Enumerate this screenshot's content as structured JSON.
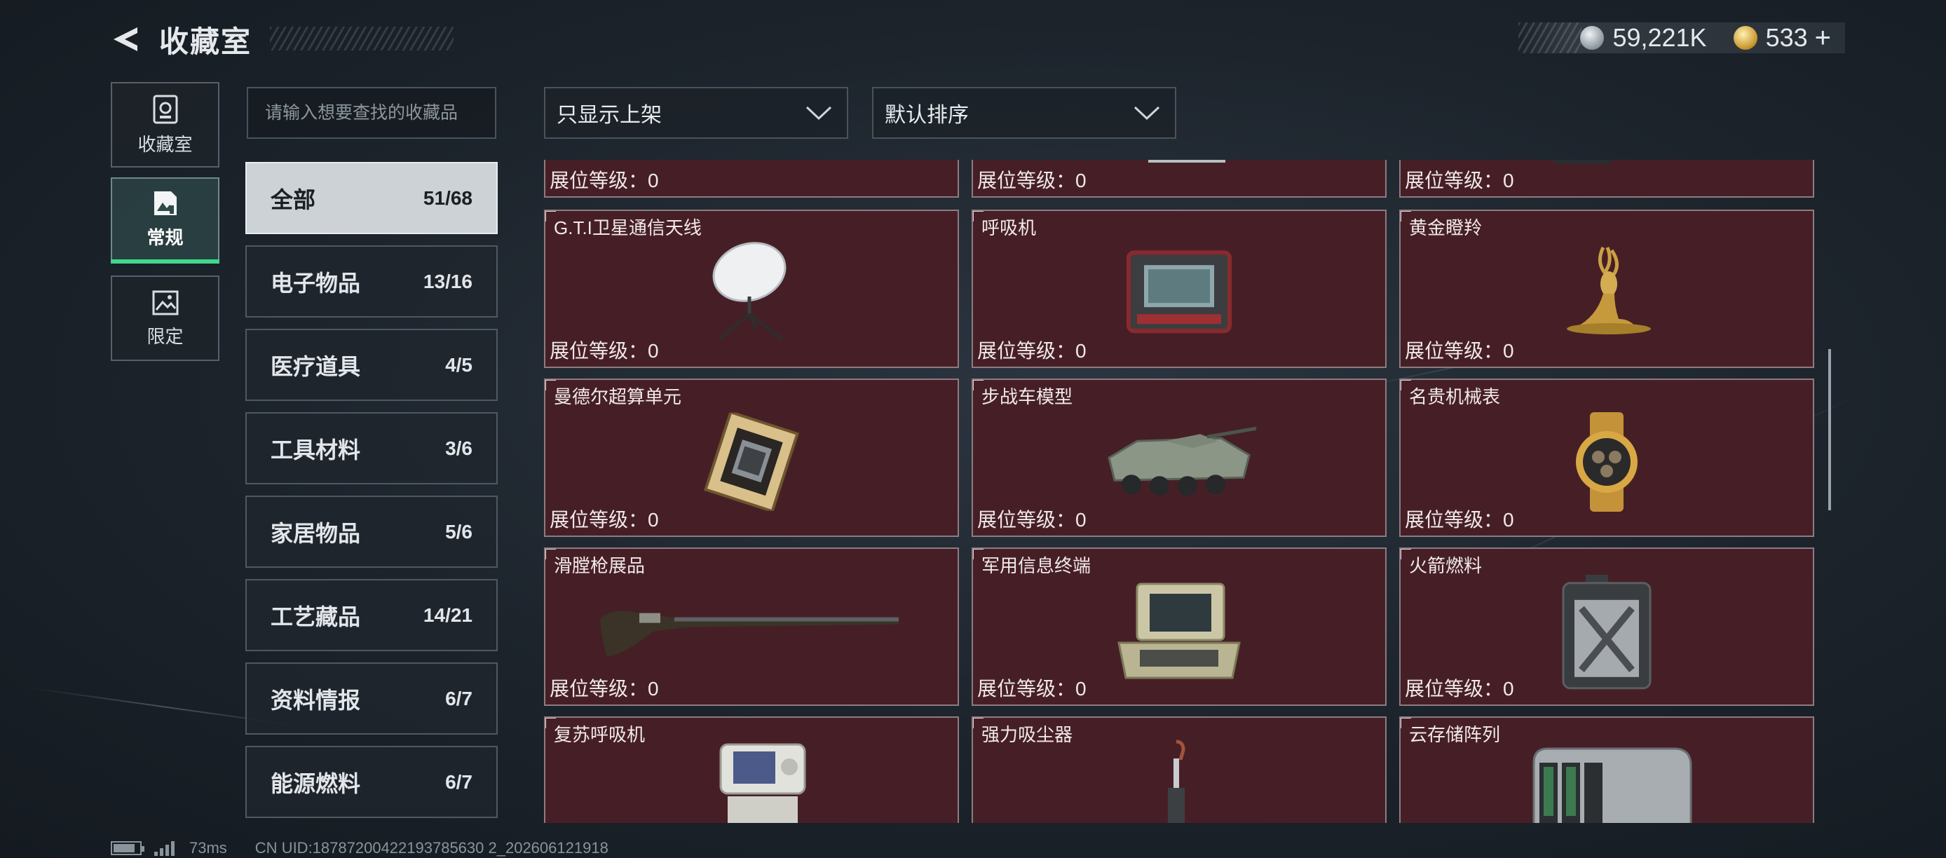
{
  "header": {
    "title": "收藏室"
  },
  "currency": {
    "silver": "59,221K",
    "gold": "533",
    "plus": "+"
  },
  "side_tabs": [
    {
      "label": "收藏室",
      "icon": "collection-icon"
    },
    {
      "label": "常规",
      "icon": "image-icon"
    },
    {
      "label": "限定",
      "icon": "landscape-icon"
    }
  ],
  "search": {
    "placeholder": "请输入想要查找的收藏品"
  },
  "filters": {
    "show_filter": "只显示上架",
    "sort": "默认排序"
  },
  "categories": [
    {
      "name": "全部",
      "count": "51/68"
    },
    {
      "name": "电子物品",
      "count": "13/16"
    },
    {
      "name": "医疗道具",
      "count": "4/5"
    },
    {
      "name": "工具材料",
      "count": "3/6"
    },
    {
      "name": "家居物品",
      "count": "5/6"
    },
    {
      "name": "工艺藏品",
      "count": "14/21"
    },
    {
      "name": "资料情报",
      "count": "6/7"
    },
    {
      "name": "能源燃料",
      "count": "6/7"
    }
  ],
  "level_text": "展位等级：0",
  "items": [
    {
      "name": "",
      "level": "展位等级：0"
    },
    {
      "name": "",
      "level": "展位等级：0"
    },
    {
      "name": "",
      "level": "展位等级：0"
    },
    {
      "name": "G.T.I卫星通信天线",
      "level": "展位等级：0"
    },
    {
      "name": "呼吸机",
      "level": "展位等级：0"
    },
    {
      "name": "黄金瞪羚",
      "level": "展位等级：0"
    },
    {
      "name": "曼德尔超算单元",
      "level": "展位等级：0"
    },
    {
      "name": "步战车模型",
      "level": "展位等级：0"
    },
    {
      "name": "名贵机械表",
      "level": "展位等级：0"
    },
    {
      "name": "滑膛枪展品",
      "level": "展位等级：0"
    },
    {
      "name": "军用信息终端",
      "level": "展位等级：0"
    },
    {
      "name": "火箭燃料",
      "level": "展位等级：0"
    },
    {
      "name": "复苏呼吸机",
      "level": ""
    },
    {
      "name": "强力吸尘器",
      "level": ""
    },
    {
      "name": "云存储阵列",
      "level": ""
    }
  ],
  "status": {
    "ping": "73ms",
    "uid": "CN UID:18787200422193785630 2_202606121918"
  }
}
